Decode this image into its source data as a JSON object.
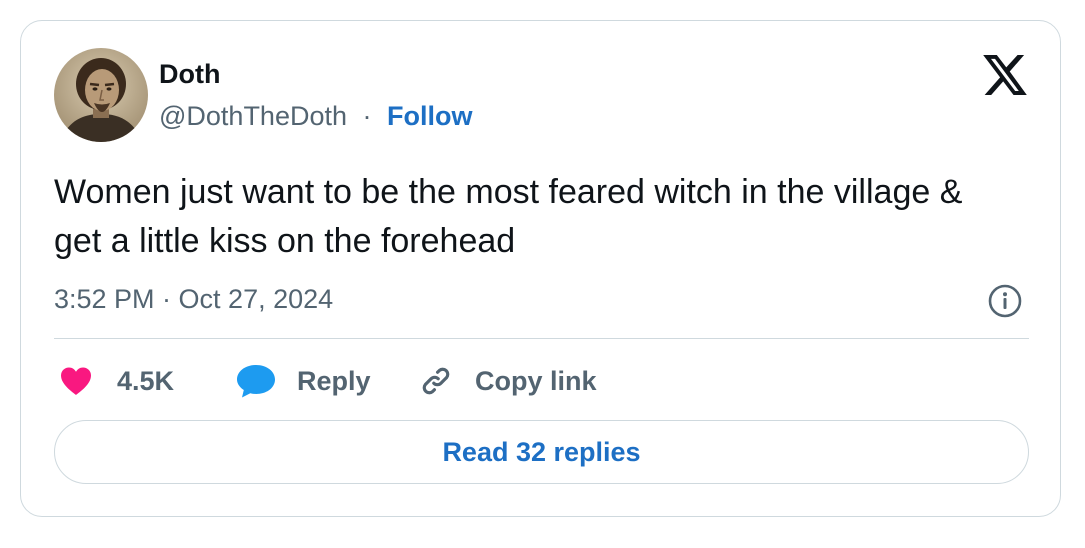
{
  "author": {
    "name": "Doth",
    "handle": "@DothTheDoth",
    "separator": "·",
    "follow_label": "Follow",
    "avatar_icon": "portrait-avatar"
  },
  "platform_icon": "x-logo-icon",
  "tweet": {
    "text": "Women just want to be the most feared witch in the village & get a little kiss on the forehead",
    "timestamp": "3:52 PM · Oct 27, 2024"
  },
  "actions": {
    "like_count": "4.5K",
    "reply_label": "Reply",
    "copy_link_label": "Copy link"
  },
  "footer": {
    "read_replies_label": "Read 32 replies"
  },
  "colors": {
    "accent": "#1d6fc4",
    "like": "#f91880",
    "reply": "#1d9bf0",
    "muted": "#536471",
    "border": "#cfd9de",
    "text": "#0f1419"
  }
}
